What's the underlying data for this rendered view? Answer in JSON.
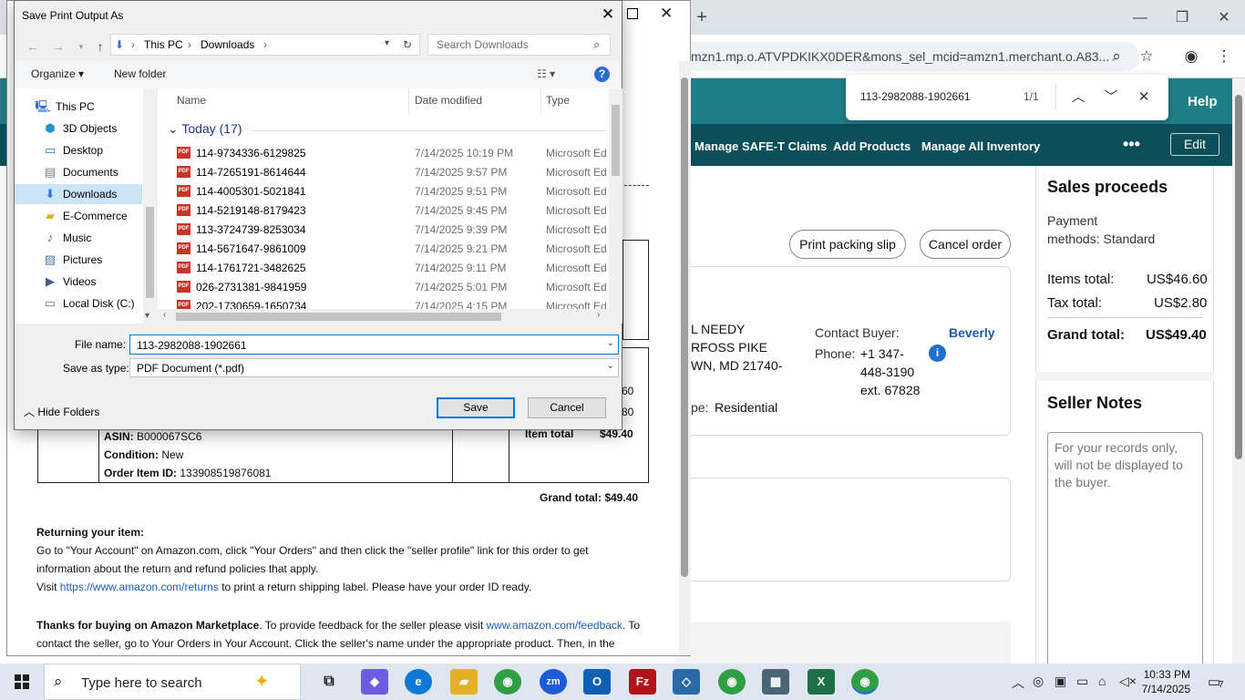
{
  "browser": {
    "new_tab": "+",
    "win_controls": [
      "—",
      "❐",
      "✕"
    ],
    "url": "mzn1.mp.o.ATVPDKIKX0DER&mons_sel_mcid=amzn1.merchant.o.A83...",
    "nav_help": "Help",
    "nav_links": [
      "Manage SAFE-T Claims",
      "Add Products",
      "Manage All Inventory"
    ],
    "nav_more": "•••",
    "nav_edit": "Edit"
  },
  "find_bar": {
    "query": "113-2982088-1902661",
    "count": "1/1"
  },
  "order_page": {
    "print_packing_slip": "Print packing slip",
    "cancel_order": "Cancel order",
    "ship_lines": [
      "L NEEDY",
      "RFOSS PIKE",
      "WN, MD 21740-"
    ],
    "contact_buyer_label": "Contact Buyer:",
    "buyer_name": "Beverly",
    "phone_label": "Phone:",
    "phone_lines": [
      "+1 347-",
      "448-3190",
      "ext. 67828"
    ],
    "address_type_label": "pe:",
    "address_type": "Residential",
    "sales_proceeds": {
      "title": "Sales proceeds",
      "payment_line1": "Payment",
      "payment_line2": "methods: Standard",
      "items_total_label": "Items total:",
      "items_total": "US$46.60",
      "tax_total_label": "Tax total:",
      "tax_total": "US$2.80",
      "grand_total_label": "Grand total:",
      "grand_total": "US$49.40"
    },
    "seller_notes": {
      "title": "Seller Notes",
      "placeholder": "For your records only, will not be displayed to the buyer."
    }
  },
  "print_preview": {
    "asin_label": "ASIN:",
    "asin": "B000067SC6",
    "condition_label": "Condition:",
    "condition": "New",
    "order_item_id_label": "Order Item ID:",
    "order_item_id": "133908519876081",
    "val1": "60",
    "val2": "80",
    "item_total_label": "Item total",
    "item_total": "$49.40",
    "grand_total": "Grand total: $49.40",
    "returning_title": "Returning your item:",
    "returning_p1a": "Go to \"Your Account\" on Amazon.com, click \"Your Orders\" and then click the \"seller profile\" link for this order to get",
    "returning_p1b": "information about the return and refund policies that apply.",
    "returning_p2_pre": "Visit ",
    "returning_link": "https://www.amazon.com/returns",
    "returning_p2_post": " to print a return shipping label. Please have your order ID ready.",
    "thanks_bold": "Thanks for buying on Amazon Marketplace",
    "thanks_mid": ". To provide feedback for the seller please visit ",
    "feedback_link": "www.amazon.com/feedback",
    "thanks_end": ". To",
    "thanks_line2": "contact the seller, go to Your Orders in Your Account. Click the seller's name under the appropriate product. Then, in the"
  },
  "dialog": {
    "title": "Save Print Output As",
    "close": "✕",
    "breadcrumb": [
      "This PC",
      "Downloads"
    ],
    "search_placeholder": "Search Downloads",
    "organize": "Organize ▾",
    "new_folder": "New folder",
    "help": "?",
    "nav_items": [
      {
        "label": "This PC",
        "icon": "computer-icon"
      },
      {
        "label": "3D Objects",
        "icon": "cube-icon"
      },
      {
        "label": "Desktop",
        "icon": "desktop-icon"
      },
      {
        "label": "Documents",
        "icon": "documents-icon"
      },
      {
        "label": "Downloads",
        "icon": "download-arrow-icon"
      },
      {
        "label": "E-Commerce",
        "icon": "folder-icon"
      },
      {
        "label": "Music",
        "icon": "music-note-icon"
      },
      {
        "label": "Pictures",
        "icon": "pictures-icon"
      },
      {
        "label": "Videos",
        "icon": "videos-icon"
      },
      {
        "label": "Local Disk (C:)",
        "icon": "disk-icon"
      }
    ],
    "columns": [
      "Name",
      "Date modified",
      "Type"
    ],
    "group": "Today (17)",
    "files": [
      {
        "name": "114-9734336-6129825",
        "date": "7/14/2025 10:19 PM",
        "type": "Microsoft Ed"
      },
      {
        "name": "114-7265191-8614644",
        "date": "7/14/2025 9:57 PM",
        "type": "Microsoft Ed"
      },
      {
        "name": "114-4005301-5021841",
        "date": "7/14/2025 9:51 PM",
        "type": "Microsoft Ed"
      },
      {
        "name": "114-5219148-8179423",
        "date": "7/14/2025 9:45 PM",
        "type": "Microsoft Ed"
      },
      {
        "name": "113-3724739-8253034",
        "date": "7/14/2025 9:39 PM",
        "type": "Microsoft Ed"
      },
      {
        "name": "114-5671647-9861009",
        "date": "7/14/2025 9:21 PM",
        "type": "Microsoft Ed"
      },
      {
        "name": "114-1761721-3482625",
        "date": "7/14/2025 9:11 PM",
        "type": "Microsoft Ed"
      },
      {
        "name": "026-2731381-9841959",
        "date": "7/14/2025 5:01 PM",
        "type": "Microsoft Ed"
      },
      {
        "name": "202-1730659-1650734",
        "date": "7/14/2025 4:15 PM",
        "type": "Microsoft Ed"
      }
    ],
    "file_name_label": "File name:",
    "file_name": "113-2982088-1902661",
    "save_type_label": "Save as type:",
    "save_type": "PDF Document (*.pdf)",
    "hide_folders": "Hide Folders",
    "save": "Save",
    "cancel": "Cancel"
  },
  "taskbar": {
    "search_placeholder": "Type here to search",
    "time": "10:33 PM",
    "date": "7/14/2025",
    "notifications": "7"
  }
}
